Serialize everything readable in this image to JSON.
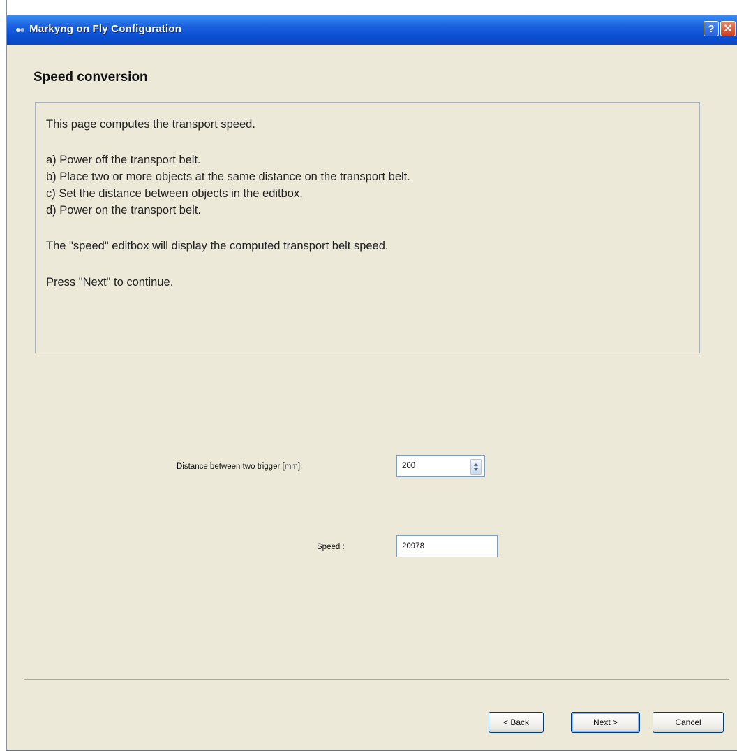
{
  "window": {
    "title": "Markyng on Fly Configuration",
    "help_label": "?",
    "close_label": "✕"
  },
  "page": {
    "heading": "Speed conversion",
    "info": {
      "intro": "This page computes the transport speed.",
      "step_a": "a) Power off the transport belt.",
      "step_b": "b) Place two or more objects at the same distance on the transport belt.",
      "step_c": "c) Set the distance between objects in the editbox.",
      "step_d": "d) Power on the transport belt.",
      "speed_note": "The \"speed\" editbox will display the computed transport belt speed.",
      "continue_note": "Press \"Next\" to continue."
    }
  },
  "form": {
    "distance_label": "Distance between two trigger [mm]:",
    "distance_value": "200",
    "speed_label": "Speed :",
    "speed_value": "20978"
  },
  "buttons": {
    "back": "< Back",
    "next": "Next >",
    "cancel": "Cancel"
  }
}
